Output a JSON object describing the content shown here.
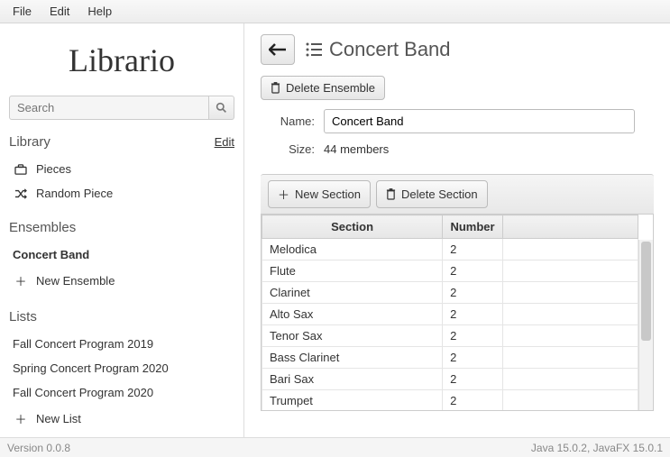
{
  "menubar": [
    "File",
    "Edit",
    "Help"
  ],
  "app_name": "Librario",
  "search": {
    "placeholder": "Search"
  },
  "sidebar": {
    "library": {
      "title": "Library",
      "edit": "Edit",
      "items": [
        {
          "label": "Pieces"
        },
        {
          "label": "Random Piece"
        }
      ]
    },
    "ensembles": {
      "title": "Ensembles",
      "items": [
        {
          "label": "Concert Band",
          "selected": true
        }
      ],
      "new_label": "New Ensemble"
    },
    "lists": {
      "title": "Lists",
      "items": [
        {
          "label": "Fall Concert Program 2019"
        },
        {
          "label": "Spring Concert Program 2020"
        },
        {
          "label": "Fall Concert Program 2020"
        }
      ],
      "new_label": "New List"
    }
  },
  "content": {
    "title": "Concert Band",
    "delete_ensemble": "Delete Ensemble",
    "name_label": "Name:",
    "name_value": "Concert Band",
    "size_label": "Size:",
    "size_value": "44 members",
    "new_section": "New Section",
    "delete_section": "Delete Section",
    "columns": [
      "Section",
      "Number"
    ],
    "rows": [
      {
        "section": "Melodica",
        "number": "2"
      },
      {
        "section": "Flute",
        "number": "2"
      },
      {
        "section": "Clarinet",
        "number": "2"
      },
      {
        "section": "Alto Sax",
        "number": "2"
      },
      {
        "section": "Tenor Sax",
        "number": "2"
      },
      {
        "section": "Bass Clarinet",
        "number": "2"
      },
      {
        "section": "Bari Sax",
        "number": "2"
      },
      {
        "section": "Trumpet",
        "number": "2"
      }
    ]
  },
  "status": {
    "left": "Version 0.0.8",
    "right": "Java 15.0.2, JavaFX 15.0.1"
  }
}
